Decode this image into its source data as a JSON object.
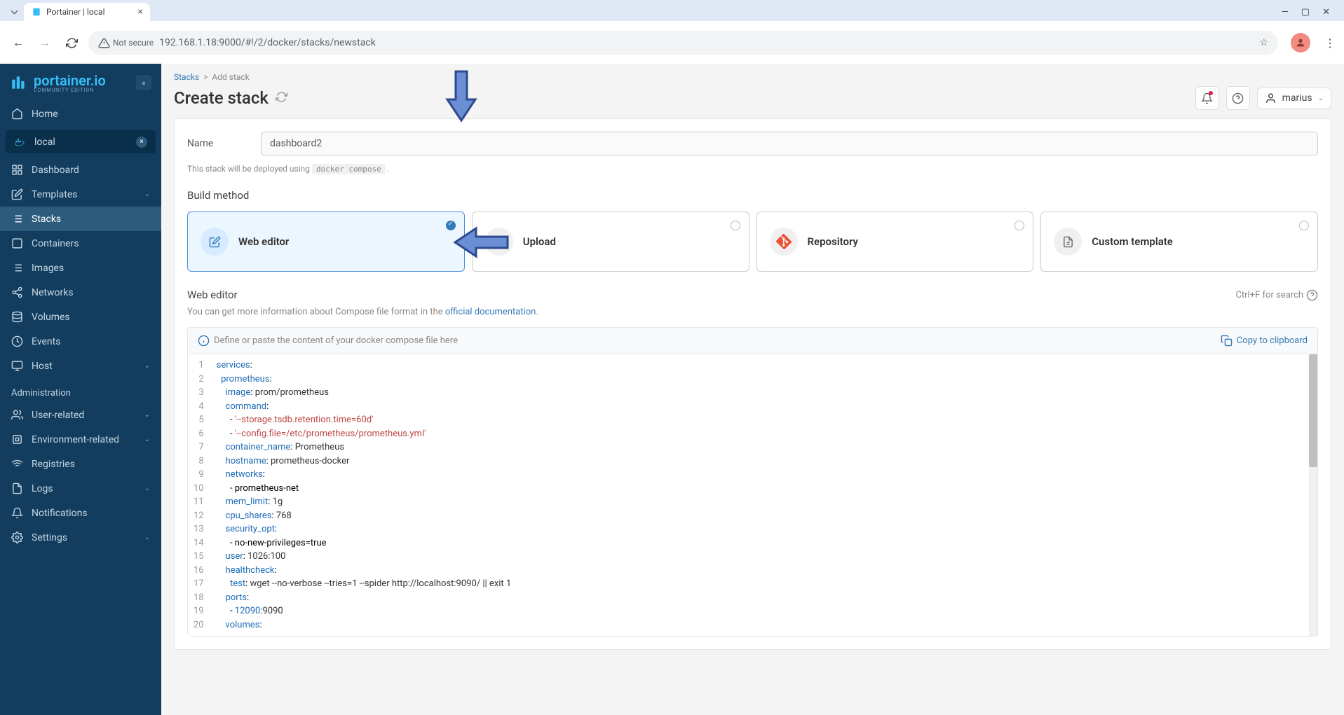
{
  "browser": {
    "tab_title": "Portainer | local",
    "security": "Not secure",
    "url": "192.168.1.18:9000/#!/2/docker/stacks/newstack"
  },
  "logo": {
    "name": "portainer.io",
    "sub": "COMMUNITY EDITION"
  },
  "sidebar": {
    "home": "Home",
    "env": "local",
    "items": [
      "Dashboard",
      "Templates",
      "Stacks",
      "Containers",
      "Images",
      "Networks",
      "Volumes",
      "Events",
      "Host"
    ],
    "admin_title": "Administration",
    "admin_items": [
      "User-related",
      "Environment-related",
      "Registries",
      "Logs",
      "Notifications",
      "Settings"
    ]
  },
  "breadcrumb": {
    "root": "Stacks",
    "current": "Add stack"
  },
  "page_title": "Create stack",
  "user": "marius",
  "form": {
    "name_label": "Name",
    "name_value": "dashboard2",
    "deploy_note_pre": "This stack will be deployed using ",
    "deploy_note_code": "docker compose",
    "deploy_note_post": ".",
    "build_title": "Build method",
    "methods": [
      "Web editor",
      "Upload",
      "Repository",
      "Custom template"
    ]
  },
  "editor": {
    "title": "Web editor",
    "search_hint": "Ctrl+F for search",
    "desc_pre": "You can get more information about Compose file format in the ",
    "desc_link": "official documentation",
    "desc_post": ".",
    "placeholder": "Define or paste the content of your docker compose file here",
    "copy": "Copy to clipboard",
    "lines": [
      {
        "n": 1,
        "raw": "services:"
      },
      {
        "n": 2,
        "raw": "  prometheus:"
      },
      {
        "n": 3,
        "raw": "    image: prom/prometheus"
      },
      {
        "n": 4,
        "raw": "    command:"
      },
      {
        "n": 5,
        "raw": "      - '--storage.tsdb.retention.time=60d'"
      },
      {
        "n": 6,
        "raw": "      - '--config.file=/etc/prometheus/prometheus.yml'"
      },
      {
        "n": 7,
        "raw": "    container_name: Prometheus"
      },
      {
        "n": 8,
        "raw": "    hostname: prometheus-docker"
      },
      {
        "n": 9,
        "raw": "    networks:"
      },
      {
        "n": 10,
        "raw": "      - prometheus-net"
      },
      {
        "n": 11,
        "raw": "    mem_limit: 1g"
      },
      {
        "n": 12,
        "raw": "    cpu_shares: 768"
      },
      {
        "n": 13,
        "raw": "    security_opt:"
      },
      {
        "n": 14,
        "raw": "      - no-new-privileges=true"
      },
      {
        "n": 15,
        "raw": "    user: 1026:100"
      },
      {
        "n": 16,
        "raw": "    healthcheck:"
      },
      {
        "n": 17,
        "raw": "      test: wget --no-verbose --tries=1 --spider http://localhost:9090/ || exit 1"
      },
      {
        "n": 18,
        "raw": "    ports:"
      },
      {
        "n": 19,
        "raw": "      - 12090:9090"
      },
      {
        "n": 20,
        "raw": "    volumes:"
      }
    ]
  }
}
